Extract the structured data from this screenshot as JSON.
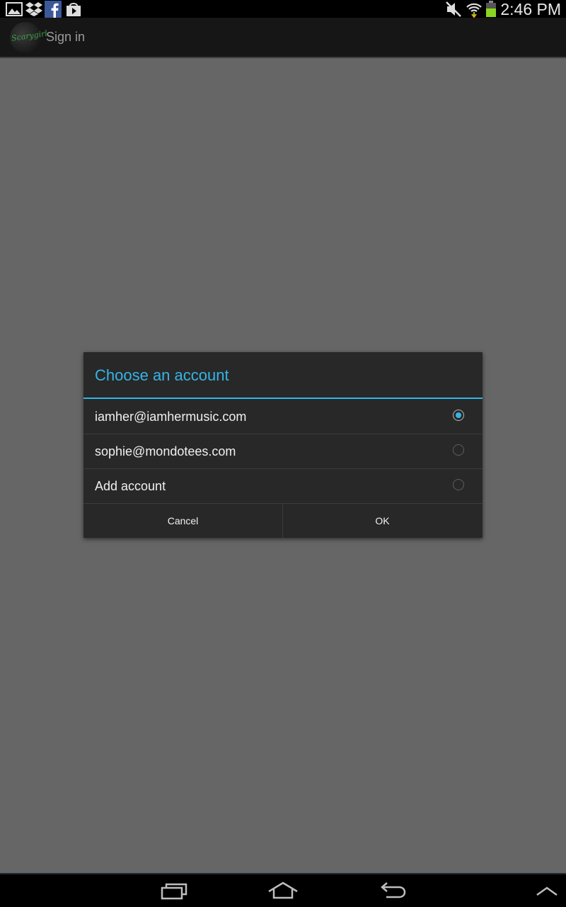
{
  "status_bar": {
    "time": "2:46 PM",
    "left_icons": [
      "gallery-icon",
      "dropbox-icon",
      "facebook-icon",
      "play-store-icon"
    ],
    "right_icons": [
      "mute-icon",
      "wifi-icon",
      "battery-icon"
    ]
  },
  "action_bar": {
    "logo_text": "Scarygirl",
    "title": "Sign in"
  },
  "dialog": {
    "title": "Choose an account",
    "accent_color": "#33b5e5",
    "options": [
      {
        "label": "iamher@iamhermusic.com",
        "selected": true
      },
      {
        "label": "sophie@mondotees.com",
        "selected": false
      },
      {
        "label": "Add account",
        "selected": false
      }
    ],
    "cancel_label": "Cancel",
    "ok_label": "OK"
  },
  "nav_bar": {
    "icons": [
      "recent-apps-icon",
      "home-icon",
      "back-icon",
      "menu-up-icon"
    ]
  }
}
